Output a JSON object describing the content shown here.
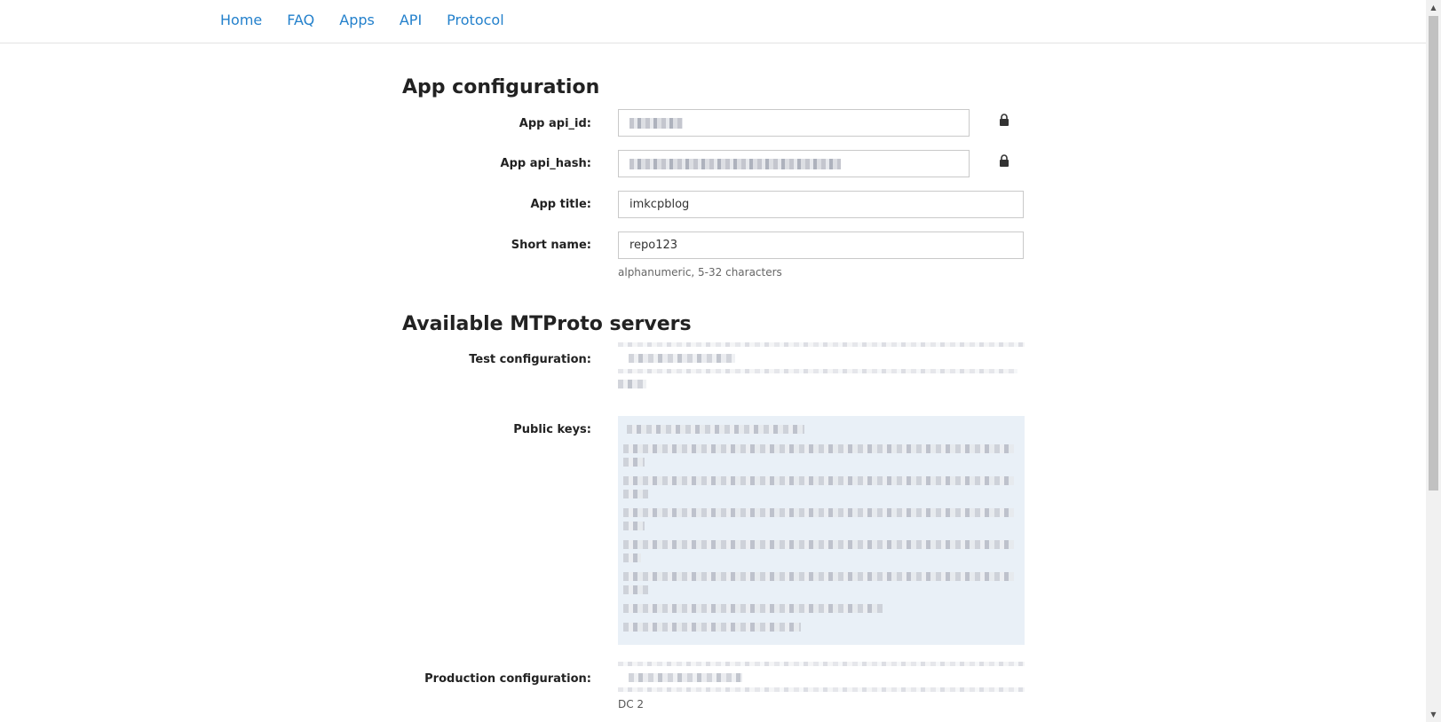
{
  "nav": {
    "items": [
      {
        "label": "Home"
      },
      {
        "label": "FAQ"
      },
      {
        "label": "Apps"
      },
      {
        "label": "API"
      },
      {
        "label": "Protocol"
      }
    ]
  },
  "app_config": {
    "title": "App configuration",
    "api_id_label": "App api_id:",
    "api_hash_label": "App api_hash:",
    "app_title_label": "App title:",
    "app_title_value": "imkcpblog",
    "short_name_label": "Short name:",
    "short_name_value": "repo123",
    "short_name_hint": "alphanumeric, 5-32 characters"
  },
  "servers": {
    "title": "Available MTProto servers",
    "test_label": "Test configuration:",
    "public_keys_label": "Public keys:",
    "production_label": "Production configuration:",
    "production_dc": "DC 2"
  },
  "icons": {
    "lock": "lock-icon"
  },
  "colors": {
    "link": "#2481cc",
    "keys_background": "#e9f0f7"
  }
}
